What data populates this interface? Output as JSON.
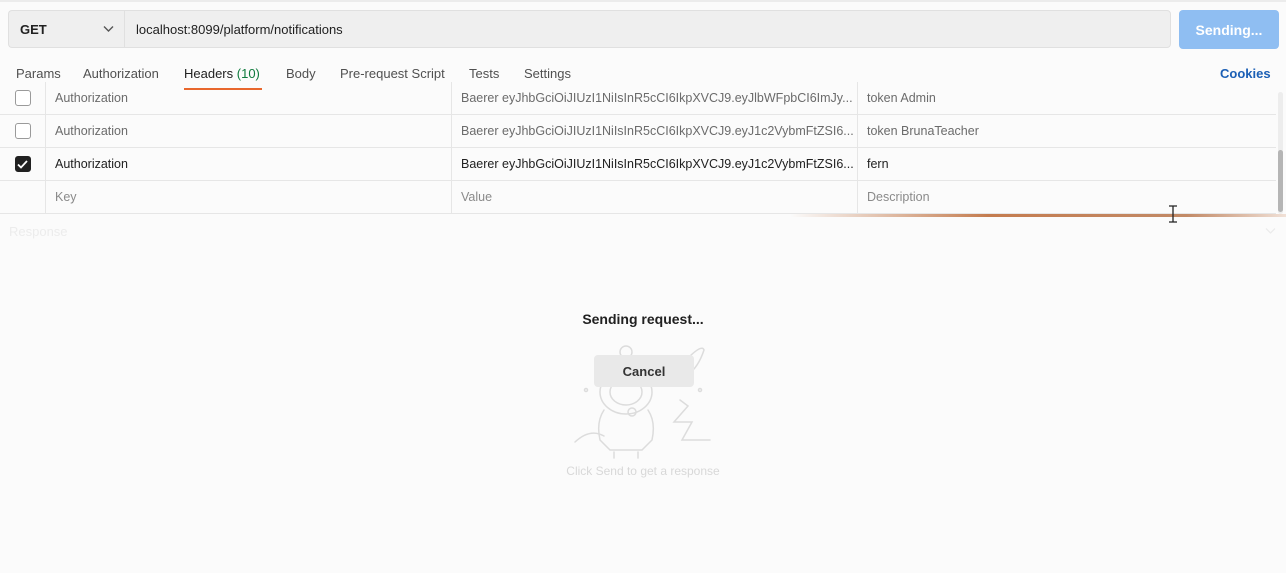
{
  "request": {
    "method": "GET",
    "url": "localhost:8099/platform/notifications",
    "send_label": "Sending..."
  },
  "tabs": [
    {
      "label": "Params"
    },
    {
      "label": "Authorization"
    },
    {
      "label": "Headers",
      "count": "(10)"
    },
    {
      "label": "Body"
    },
    {
      "label": "Pre-request Script"
    },
    {
      "label": "Tests"
    },
    {
      "label": "Settings"
    }
  ],
  "cookies_label": "Cookies",
  "headers": {
    "rows": [
      {
        "checked": false,
        "key": "Authorization",
        "value": "Baerer eyJhbGciOiJIUzI1NiIsInR5cCI6IkpXVCJ9.eyJlbWFpbCI6ImJy...",
        "description": "token Admin"
      },
      {
        "checked": false,
        "key": "Authorization",
        "value": "Baerer eyJhbGciOiJIUzI1NiIsInR5cCI6IkpXVCJ9.eyJ1c2VybmFtZSI6...",
        "description": "token BrunaTeacher"
      },
      {
        "checked": true,
        "key": "Authorization",
        "value": "Baerer eyJhbGciOiJIUzI1NiIsInR5cCI6IkpXVCJ9.eyJ1c2VybmFtZSI6...",
        "description": "fern"
      }
    ],
    "placeholder": {
      "key": "Key",
      "value": "Value",
      "description": "Description"
    }
  },
  "response": {
    "label": "Response",
    "sending_text": "Sending request...",
    "cancel_label": "Cancel",
    "hint": "Click Send to get a response"
  }
}
